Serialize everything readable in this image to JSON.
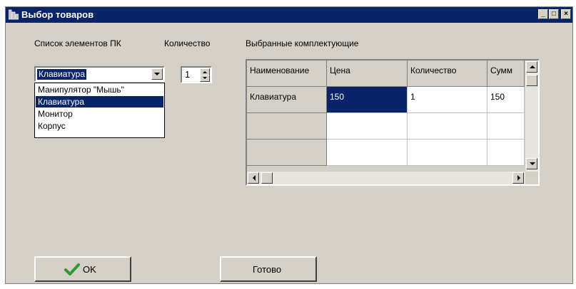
{
  "window": {
    "title": "Выбор товаров",
    "title_icon": "app-icon"
  },
  "titlebar_buttons": {
    "minimize": "_",
    "maximize": "□",
    "close": "×"
  },
  "labels": {
    "pc_elements": "Список элементов ПК",
    "quantity": "Количество",
    "selected": "Выбранные комплектующие"
  },
  "combo": {
    "value": "Клавиатура",
    "options": [
      "Манипулятор \"Мышь\"",
      "Клавиатура",
      "Монитор",
      "Корпус"
    ],
    "selected_index": 1
  },
  "spin": {
    "value": "1"
  },
  "grid": {
    "headers": [
      "Наименование",
      "Цена",
      "Количество",
      "Сумм"
    ],
    "rows": [
      [
        "Клавиатура",
        "150",
        "1",
        "150"
      ],
      [
        "",
        "",
        "",
        ""
      ],
      [
        "",
        "",
        "",
        ""
      ]
    ]
  },
  "buttons": {
    "ok": "OK",
    "done": "Готово"
  },
  "colors": {
    "titlebar": "#0a246a",
    "face": "#d4d0c8",
    "selection": "#0a246a",
    "ok_check": "#2e9a2e"
  }
}
